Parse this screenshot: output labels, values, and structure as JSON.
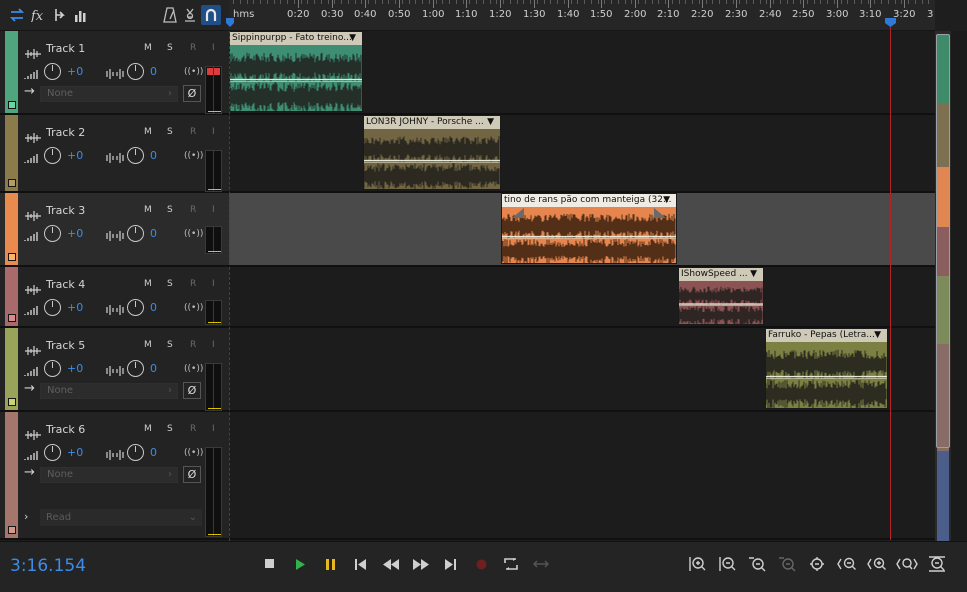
{
  "toolbar": {
    "buttons": [
      "waveform-multitrack-toggle-icon",
      "fx-icon",
      "send-icon",
      "meter-icon",
      "metronome-icon",
      "snap-icon",
      "loop-icon"
    ]
  },
  "ruler": {
    "labels": [
      "hms",
      "0:20",
      "0:30",
      "0:40",
      "0:50",
      "1:00",
      "1:10",
      "1:20",
      "1:30",
      "1:40",
      "1:50",
      "2:00",
      "2:10",
      "2:20",
      "2:30",
      "2:40",
      "2:50",
      "3:00",
      "3:10",
      "3:20",
      "3"
    ]
  },
  "common": {
    "mute": "M",
    "solo": "S",
    "arm": "R",
    "input": "I",
    "rec_wave": "((•))",
    "phase": "Ø",
    "input_arrow": "→",
    "input_none": "None",
    "chevron": "›",
    "expander": "›",
    "read": "Read",
    "read_chev": "⌄"
  },
  "tracks": [
    {
      "name": "Track 1",
      "volume": "+0",
      "pan": "0",
      "color": "#4ea57e",
      "selected": false,
      "clip": {
        "title": "Sippinpurpp - Fato treino...",
        "color": "#3e8e74"
      }
    },
    {
      "name": "Track 2",
      "volume": "+0",
      "pan": "0",
      "color": "#8b7a4a",
      "selected": false,
      "clip": {
        "title": "LON3R JOHNY - Porsche ...",
        "color": "#726543"
      }
    },
    {
      "name": "Track 3",
      "volume": "+0",
      "pan": "0",
      "color": "#e98a4e",
      "selected": true,
      "clip": {
        "title": "tino de rans pão com manteiga (32...",
        "color": "#e6864e"
      }
    },
    {
      "name": "Track 4",
      "volume": "+0",
      "pan": "0",
      "color": "#a86a6a",
      "selected": false,
      "clip": {
        "title": "IShowSpeed ...",
        "color": "#8b5353"
      }
    },
    {
      "name": "Track 5",
      "volume": "+0",
      "pan": "0",
      "color": "#9aa35a",
      "selected": false,
      "clip": {
        "title": "Farruko - Pepas (Letra...",
        "color": "#7c8143"
      }
    },
    {
      "name": "Track 6",
      "volume": "+0",
      "pan": "0",
      "color": "#a4766c",
      "selected": false
    }
  ],
  "overview_colors": [
    "#3f8a69",
    "#7c7050",
    "#e08652",
    "#8a5e5e",
    "#7d8a5a",
    "#8a6c66",
    "#4b5e8a"
  ],
  "transport": {
    "timecode": "3:16.154",
    "buttons": [
      "stop",
      "play",
      "pause",
      "go-to-start",
      "rewind",
      "fast-forward",
      "go-to-end",
      "record",
      "loop-playback",
      "skip-selection"
    ]
  },
  "zoom": {
    "buttons": [
      "zoom-in-amplitude",
      "zoom-out-amplitude",
      "zoom-to-selection",
      "zoom-out-full",
      "zoom-in-time",
      "zoom-in-at-playhead",
      "zoom-in-out",
      "zoom-out-time",
      "zoom-full",
      "zoom-tracks"
    ]
  }
}
